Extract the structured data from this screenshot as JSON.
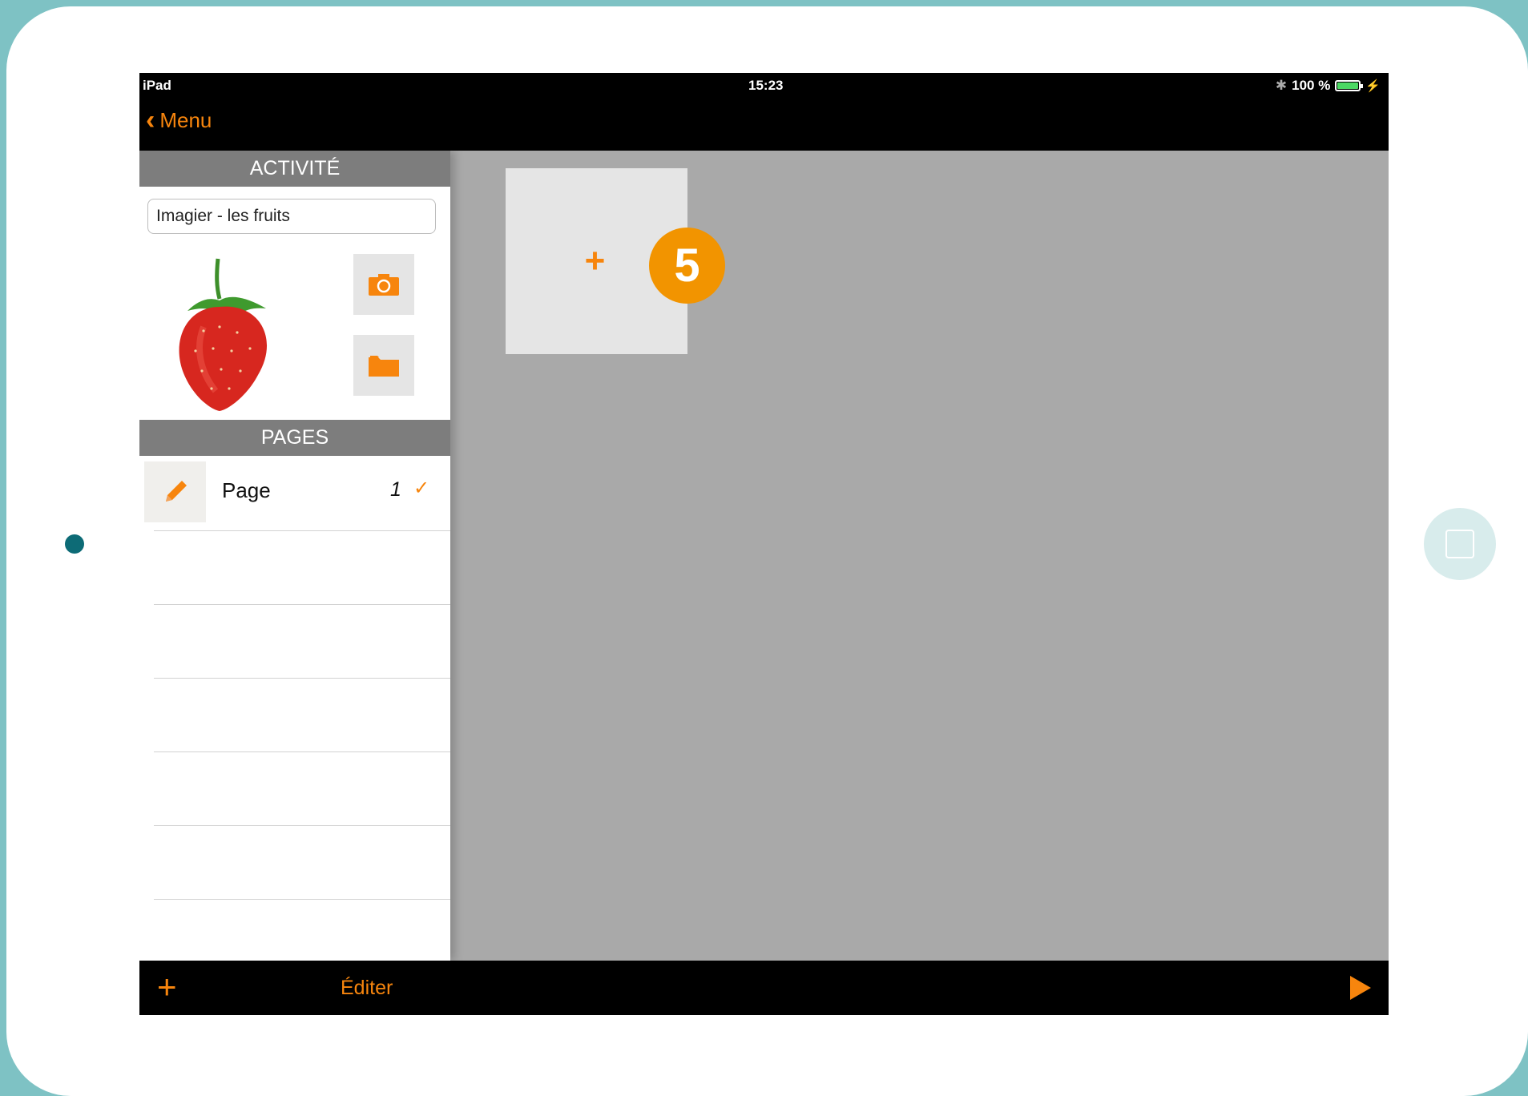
{
  "status_bar": {
    "device": "iPad",
    "time": "15:23",
    "battery": "100 %"
  },
  "nav": {
    "back_label": "Menu"
  },
  "activity": {
    "header": "ACTIVITÉ",
    "name_value": "Imagier - les fruits"
  },
  "pages": {
    "header": "PAGES",
    "items": [
      {
        "label": "Page",
        "number": "1",
        "checked": true
      }
    ]
  },
  "canvas": {
    "add_tile_symbol": "+",
    "callout_number": "5"
  },
  "toolbar": {
    "add_symbol": "+",
    "edit_label": "Éditer"
  },
  "colors": {
    "accent": "#f7850d",
    "badge": "#f29400",
    "frame": "#7ec2c4",
    "canvas_bg": "#a9a9a9"
  },
  "icons": [
    "chevron-left-icon",
    "camera-icon",
    "folder-icon",
    "pencil-icon",
    "checkmark-icon",
    "plus-icon",
    "play-icon",
    "bluetooth-icon",
    "battery-icon"
  ]
}
